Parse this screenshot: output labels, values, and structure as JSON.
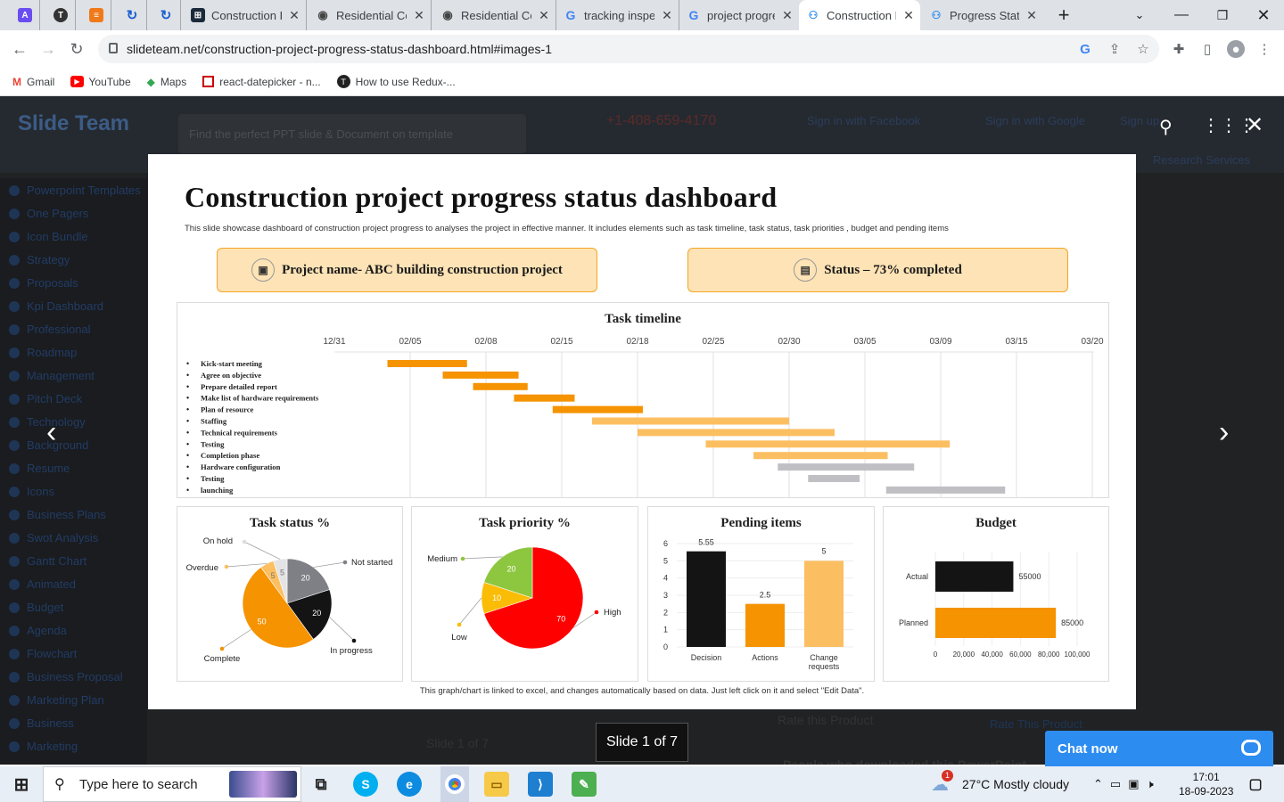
{
  "browser": {
    "tabs": [
      {
        "label": "",
        "icon": "app-icon-purple"
      },
      {
        "label": "",
        "icon": "app-icon-dark"
      },
      {
        "label": "",
        "icon": "app-icon-orange"
      },
      {
        "label": "",
        "icon": "sync-icon"
      },
      {
        "label": "",
        "icon": "sync-icon"
      },
      {
        "label": "Construction P",
        "icon": "site-icon"
      },
      {
        "label": "Residential Co",
        "icon": "maps-pin-icon"
      },
      {
        "label": "Residential Co",
        "icon": "maps-pin-icon"
      },
      {
        "label": "tracking inspe",
        "icon": "google-icon"
      },
      {
        "label": "project progre",
        "icon": "google-icon"
      },
      {
        "label": "Construction P",
        "icon": "slideteam-icon"
      },
      {
        "label": "Progress Statu",
        "icon": "slideteam-icon"
      }
    ],
    "url": "slideteam.net/construction-project-progress-status-dashboard.html#images-1",
    "bookmarks": [
      {
        "label": "Gmail",
        "icon": "gmail-icon"
      },
      {
        "label": "YouTube",
        "icon": "youtube-icon"
      },
      {
        "label": "Maps",
        "icon": "maps-icon"
      },
      {
        "label": "react-datepicker - n...",
        "icon": "npm-icon"
      },
      {
        "label": "How to use Redux-...",
        "icon": "github-icon"
      }
    ]
  },
  "website": {
    "logo": "Slide Team",
    "search_placeholder": "Find the perfect PPT slide & Document on template",
    "phone": "+1-408-659-4170",
    "signin_facebook": "Sign in with Facebook",
    "signin_google": "Sign in with Google",
    "signup": "Sign up",
    "research_services": "Research Services",
    "sidebar": [
      "Powerpoint Templates",
      "One Pagers",
      "Icon Bundle",
      "Strategy",
      "Proposals",
      "Kpi Dashboard",
      "Professional",
      "Roadmap",
      "Management",
      "Pitch Deck",
      "Technology",
      "Background",
      "Resume",
      "Icons",
      "Business Plans",
      "Swot Analysis",
      "Gantt Chart",
      "Animated",
      "Budget",
      "Agenda",
      "Flowchart",
      "Business Proposal",
      "Marketing Plan",
      "Business",
      "Marketing"
    ],
    "slide_counter_bg": "Slide 1 of 7",
    "rate_product": "Rate this Product",
    "rate_link": "Rate This Product",
    "people_downloaded": "People who downloaded this PowerPoint"
  },
  "slide": {
    "title": "Construction project progress status dashboard",
    "subtitle": "This slide showcase dashboard of construction project progress to analyses the project in effective manner. It includes elements such as task timeline, task status, task priorities , budget and pending items",
    "project_name": "Project name- ABC building construction project",
    "status": "Status – 73% completed",
    "footer": "This graph/chart is linked to excel, and changes automatically based on data. Just left click on it and select \"Edit Data\"."
  },
  "chart_data": [
    {
      "type": "gantt",
      "title": "Task timeline",
      "x_ticks": [
        "12/31",
        "02/05",
        "02/08",
        "02/15",
        "02/18",
        "02/25",
        "02/30",
        "03/05",
        "03/09",
        "03/15",
        "03/20"
      ],
      "tasks": [
        {
          "name": "Kick-start meeting",
          "start": 0.7,
          "end": 1.75,
          "color": "#f59300"
        },
        {
          "name": "Agree on objective",
          "start": 1.43,
          "end": 2.43,
          "color": "#f59300"
        },
        {
          "name": "Prepare detailed report",
          "start": 1.83,
          "end": 2.55,
          "color": "#f59300"
        },
        {
          "name": "Make list of hardware requirements",
          "start": 2.37,
          "end": 3.17,
          "color": "#f59300"
        },
        {
          "name": "Plan of resource",
          "start": 2.88,
          "end": 4.07,
          "color": "#f59300"
        },
        {
          "name": "Staffing",
          "start": 3.4,
          "end": 6.0,
          "color": "#fbbf62"
        },
        {
          "name": "Technical requirements",
          "start": 4.0,
          "end": 6.6,
          "color": "#fbbf62"
        },
        {
          "name": "Testing",
          "start": 4.9,
          "end": 8.12,
          "color": "#fbbf62"
        },
        {
          "name": "Completion phase",
          "start": 5.53,
          "end": 7.3,
          "color": "#fbbf62"
        },
        {
          "name": "Hardware configuration",
          "start": 5.85,
          "end": 7.65,
          "color": "#c0c0c4"
        },
        {
          "name": "Testing",
          "start": 6.25,
          "end": 6.93,
          "color": "#c0c0c4"
        },
        {
          "name": "launching",
          "start": 7.28,
          "end": 8.85,
          "color": "#c0c0c4"
        }
      ]
    },
    {
      "type": "pie",
      "title": "Task status %",
      "slices": [
        {
          "label": "Not started",
          "value": 20,
          "color": "#7f7f86"
        },
        {
          "label": "In progress",
          "value": 20,
          "color": "#141414"
        },
        {
          "label": "Complete",
          "value": 50,
          "color": "#f59300"
        },
        {
          "label": "Overdue",
          "value": 5,
          "color": "#fbbf62"
        },
        {
          "label": "On hold",
          "value": 5,
          "color": "#e4e4e4"
        }
      ]
    },
    {
      "type": "pie",
      "title": "Task priority %",
      "slices": [
        {
          "label": "High",
          "value": 70,
          "color": "#ff0000"
        },
        {
          "label": "Low",
          "value": 10,
          "color": "#fbbc05"
        },
        {
          "label": "Medium",
          "value": 20,
          "color": "#8dc63f"
        }
      ]
    },
    {
      "type": "bar",
      "title": "Pending items",
      "categories": [
        "Decision",
        "Actions",
        "Change requests"
      ],
      "values": [
        5.55,
        2.5,
        5
      ],
      "colors": [
        "#141414",
        "#f59300",
        "#fbbf62"
      ],
      "ylim": [
        0,
        6
      ],
      "y_ticks": [
        0,
        1,
        2,
        3,
        4,
        5,
        6
      ]
    },
    {
      "type": "bar_horizontal",
      "title": "Budget",
      "categories": [
        "Actual",
        "Planned"
      ],
      "values": [
        55000,
        85000
      ],
      "colors": [
        "#141414",
        "#f59300"
      ],
      "xlim": [
        0,
        100000
      ],
      "x_tick_labels": [
        "0",
        "20,000",
        "40,000",
        "60,000",
        "80,000",
        "100,000"
      ]
    }
  ],
  "overlay": {
    "slide_counter": "Slide 1 of 7",
    "chat_now": "Chat now"
  },
  "taskbar": {
    "search_placeholder": "Type here to search",
    "weather": "27°C  Mostly cloudy",
    "notification_count": "1",
    "time": "17:01",
    "date": "18-09-2023"
  }
}
